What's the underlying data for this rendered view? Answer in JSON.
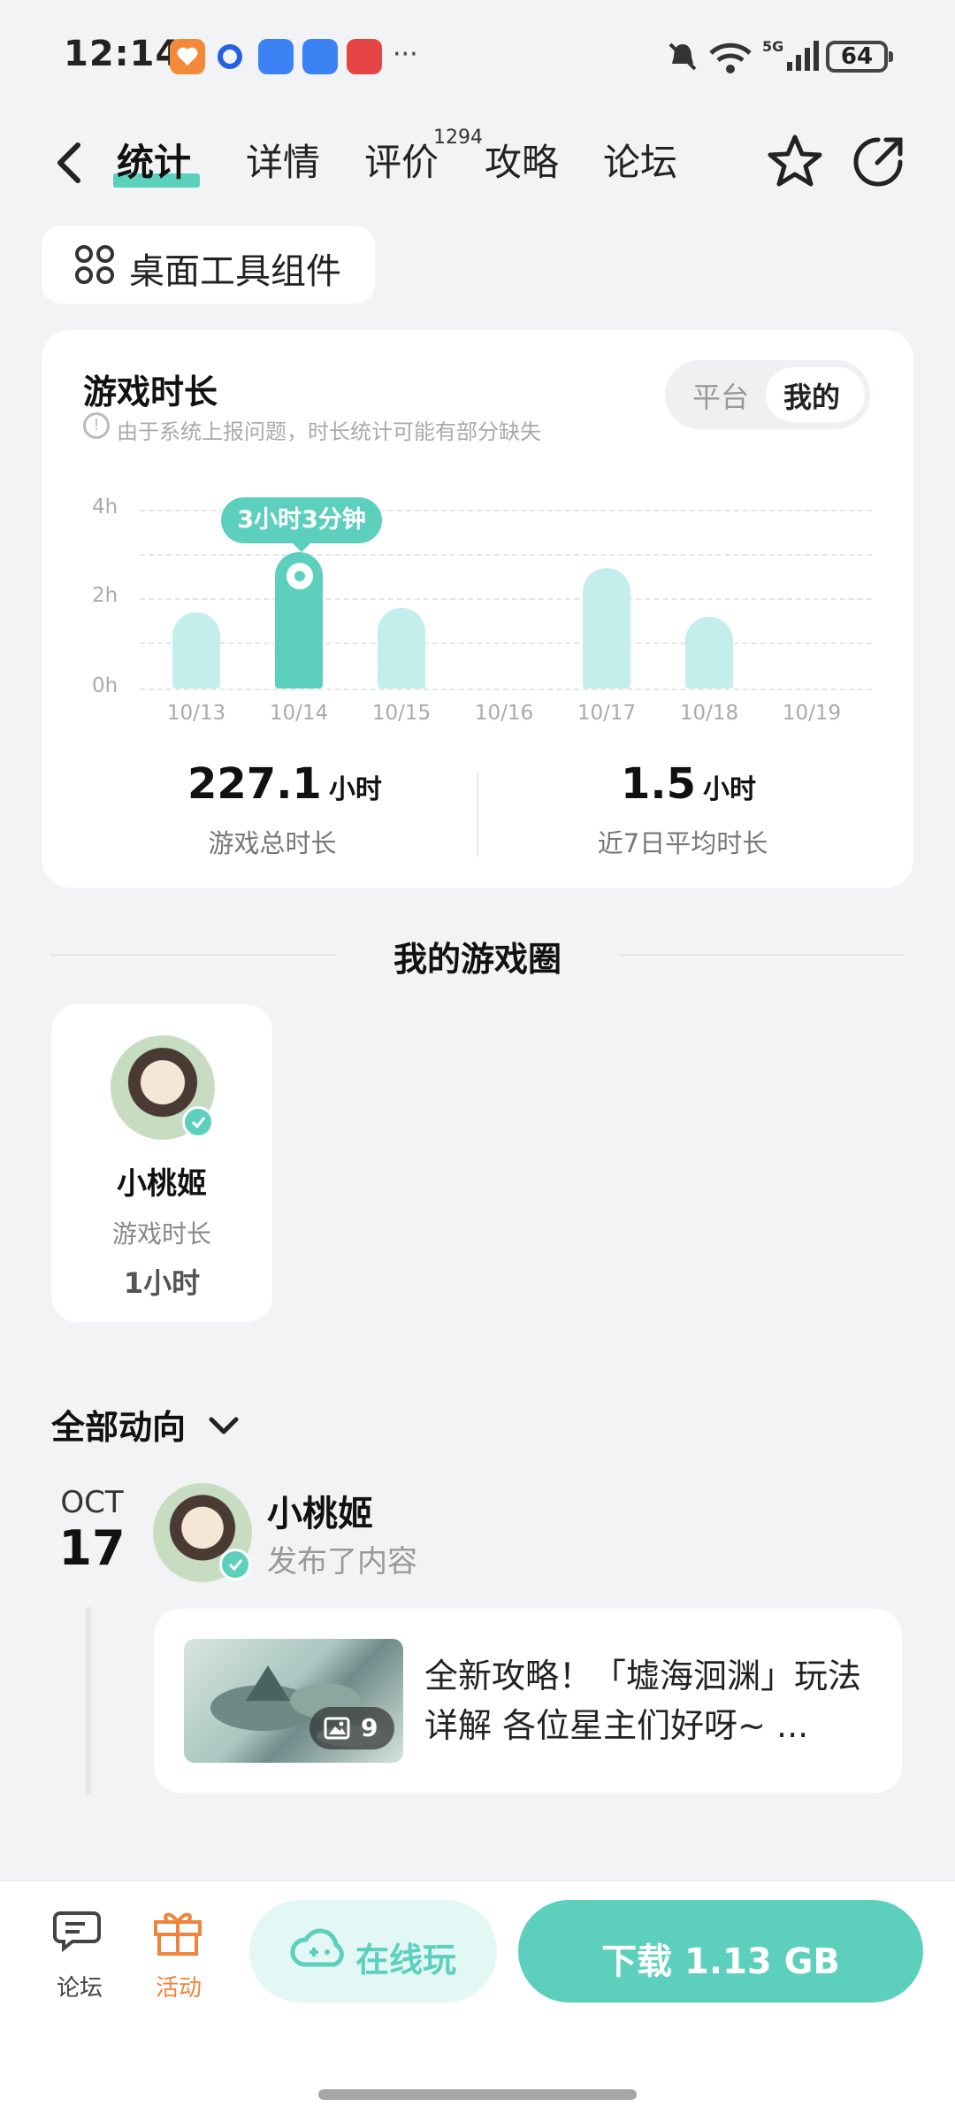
{
  "status_bar": {
    "time": "12:14",
    "battery": "64",
    "network": "5G"
  },
  "nav": {
    "tabs": [
      {
        "label": "统计",
        "active": true
      },
      {
        "label": "详情"
      },
      {
        "label": "评价",
        "badge": "1294"
      },
      {
        "label": "攻略"
      },
      {
        "label": "论坛"
      }
    ],
    "icons": [
      "back-icon",
      "star-icon",
      "share-icon"
    ]
  },
  "widget_chip": {
    "label": "桌面工具组件"
  },
  "stats": {
    "title": "游戏时长",
    "note": "由于系统上报问题，时长统计可能有部分缺失",
    "toggle": {
      "platform": "平台",
      "mine": "我的",
      "selected": "我的"
    },
    "tooltip": "3小时3分钟",
    "total_value": "227.1",
    "total_unit": "小时",
    "total_caption": "游戏总时长",
    "avg_value": "1.5",
    "avg_unit": "小时",
    "avg_caption": "近7日平均时长"
  },
  "chart_data": {
    "type": "bar",
    "categories": [
      "10/13",
      "10/14",
      "10/15",
      "10/16",
      "10/17",
      "10/18",
      "10/19"
    ],
    "values": [
      1.7,
      3.05,
      1.8,
      0,
      2.7,
      1.6,
      0
    ],
    "y_ticks": [
      "4h",
      "2h",
      "0h"
    ],
    "ylim": [
      0,
      4
    ],
    "highlight_index": 1,
    "colors": {
      "bar": "#c4eeeb",
      "selected": "#5cd0bd"
    }
  },
  "circle": {
    "title": "我的游戏圈",
    "member": {
      "name": "小桃姬",
      "caption": "游戏时长",
      "value": "1小时"
    }
  },
  "activity": {
    "filter": "全部动向",
    "month": "OCT",
    "day": "17",
    "author": "小桃姬",
    "action": "发布了内容",
    "post_text": "全新攻略！「墟海洄渊」玩法详解 各位星主们好呀~ ...",
    "image_count": "9"
  },
  "bottom": {
    "forum_label": "论坛",
    "activity_label": "活动",
    "online_label": "在线玩",
    "download_label": "下载 1.13 GB"
  },
  "colors": {
    "accent": "#5cd0bd",
    "accent_light": "#c4eeeb",
    "orange": "#f0843c"
  }
}
